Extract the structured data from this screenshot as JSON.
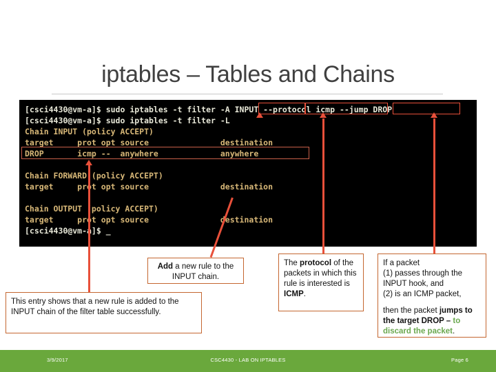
{
  "slide": {
    "title": "iptables – Tables and Chains"
  },
  "terminal": {
    "lines": [
      {
        "text": "[csci4430@vm-a]$ sudo iptables -t filter -A INPUT --protocol icmp --jump DROP",
        "style": "white"
      },
      {
        "text": "[csci4430@vm-a]$ sudo iptables -t filter -L",
        "style": "white"
      },
      {
        "text": "Chain INPUT (policy ACCEPT)",
        "style": "tan"
      },
      {
        "text": "target     prot opt source               destination",
        "style": "tan"
      },
      {
        "text": "DROP       icmp --  anywhere             anywhere",
        "style": "tan"
      },
      {
        "text": "",
        "style": "tan"
      },
      {
        "text": "Chain FORWARD (policy ACCEPT)",
        "style": "tan"
      },
      {
        "text": "target     prot opt source               destination",
        "style": "tan"
      },
      {
        "text": "",
        "style": "tan"
      },
      {
        "text": "Chain OUTPUT (policy ACCEPT)",
        "style": "tan"
      },
      {
        "text": "target     prot opt source               destination",
        "style": "tan"
      },
      {
        "text": "[csci4430@vm-a]$ _",
        "style": "white"
      }
    ],
    "highlighted_fragments": [
      "-A INPUT",
      "--protocol icmp",
      "--jump DROP"
    ],
    "highlighted_row": "DROP       icmp --  anywhere             anywhere"
  },
  "callouts": {
    "add_rule": {
      "bold": "Add",
      "rest": " a new rule to the INPUT chain."
    },
    "entry_success": {
      "text": "This entry shows that a new rule is added to the INPUT chain of the filter table successfully."
    },
    "protocol": {
      "part1": "The ",
      "bold1": "protocol",
      "part2": " of the packets in which this rule is interested is ",
      "bold2": "ICMP",
      "part3": "."
    },
    "if_packet": {
      "line1": "If a packet",
      "line2": "(1) passes through the INPUT hook, and",
      "line3": "(2) is an ICMP packet,",
      "line4_plain": "then the packet ",
      "line4_bold": "jumps to the target DROP",
      "line4_dash": " – ",
      "line4_green": "to discard the packet",
      "line4_end": "."
    }
  },
  "footer": {
    "date": "3/9/2017",
    "center": "CSC4430 - LAB ON IPTABLES",
    "page": "Page 6"
  },
  "colors": {
    "accent_red": "#e8503a",
    "callout_border": "#c4662f",
    "footer_green": "#6aa83c",
    "terminal_bg": "#000000",
    "terminal_tan": "#d8b878",
    "green_text": "#6aa84f"
  }
}
